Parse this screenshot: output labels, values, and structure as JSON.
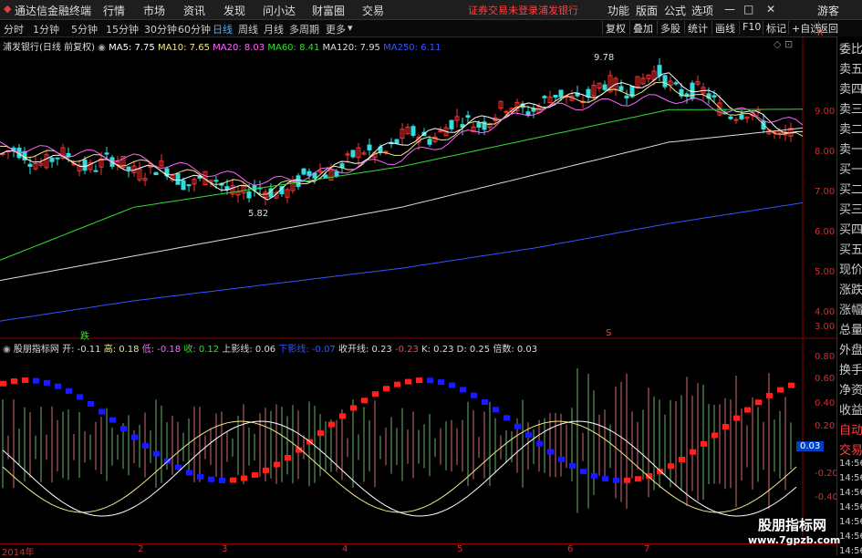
{
  "menu": {
    "app_title": "通达信金融终端",
    "items": [
      "行情",
      "市场",
      "资讯",
      "发现",
      "问小达",
      "财富圈",
      "交易"
    ],
    "notice": "证券交易未登录",
    "stock": "浦发银行",
    "right": [
      "功能",
      "版面",
      "公式",
      "选项"
    ],
    "guest": "游客",
    "win_buttons": [
      "—",
      "□",
      "✕"
    ]
  },
  "toolbar": {
    "periods": [
      "分时",
      "1分钟",
      "5分钟",
      "15分钟",
      "30分钟",
      "60分钟",
      "日线",
      "周线",
      "月线",
      "多周期",
      "更多"
    ],
    "active_period": "日线",
    "right_buttons": [
      "复权",
      "叠加",
      "多股",
      "统计",
      "画线",
      "F10",
      "标记",
      "+自选",
      "返回"
    ]
  },
  "main_legend": {
    "title": "浦发银行(日线 前复权)",
    "items": [
      {
        "label": "MA5: 7.75",
        "color": "#ffffff"
      },
      {
        "label": "MA10: 7.65",
        "color": "#f0e68c"
      },
      {
        "label": "MA20: 8.03",
        "color": "#ff66ff"
      },
      {
        "label": "MA60: 8.41",
        "color": "#33dd33"
      },
      {
        "label": "MA120: 7.95",
        "color": "#dddddd"
      },
      {
        "label": "MA250: 6.11",
        "color": "#3355ff"
      }
    ]
  },
  "price_axis": [
    "9.00",
    "8.00",
    "7.00",
    "6.00",
    "5.00",
    "4.00",
    "3.00"
  ],
  "price_annotations": {
    "high": "9.78",
    "low": "5.82"
  },
  "main_markers": {
    "fall": "跌",
    "s": "S"
  },
  "indicator_legend": {
    "title": "股朋指标网",
    "items": [
      {
        "label": "开: -0.11",
        "color": "#dddddd"
      },
      {
        "label": "高: 0.18",
        "color": "#f0e68c"
      },
      {
        "label": "低: -0.18",
        "color": "#ff66ff"
      },
      {
        "label": "收: 0.12",
        "color": "#33dd33"
      },
      {
        "label": "上影线: 0.06",
        "color": "#dddddd"
      },
      {
        "label": "下影线: -0.07",
        "color": "#3355ff"
      },
      {
        "label": "收开线: 0.23",
        "color": "#dddddd"
      },
      {
        "label": "-0.23",
        "color": "#ff4444"
      },
      {
        "label": "K: 0.23",
        "color": "#dddddd"
      },
      {
        "label": "D: 0.25",
        "color": "#dddddd"
      },
      {
        "label": "倍数: 0.03",
        "color": "#dddddd"
      }
    ]
  },
  "indicator_axis": [
    "0.80",
    "0.60",
    "0.40",
    "0.20",
    "0.03",
    "-0.20",
    "-0.40"
  ],
  "indicator_current": "0.03",
  "date_axis": [
    "2014年",
    "2",
    "3",
    "4",
    "5",
    "6",
    "7"
  ],
  "side_panel": [
    "委比",
    "卖五",
    "卖四",
    "卖三",
    "卖二",
    "卖一",
    "买一",
    "买二",
    "买三",
    "买四",
    "买五",
    "现价",
    "涨跌",
    "涨幅",
    "总量",
    "外盘",
    "换手",
    "净资",
    "收益",
    "自动",
    "交易",
    "14:56",
    "14:56",
    "14:56",
    "14:56",
    "14:56",
    "14:56",
    "14:56",
    "14:56",
    "14:56"
  ],
  "watermark": {
    "line1": "股朋指标网",
    "line2": "www.7gpzb.com"
  },
  "chart_data": {
    "type": "line",
    "title": "浦发银行(日线 前复权)",
    "x": [
      "2014-01",
      "2014-02",
      "2014-03",
      "2014-04",
      "2014-05",
      "2014-06",
      "2014-07"
    ],
    "series": [
      {
        "name": "MA5",
        "values": [
          7.3,
          7.0,
          6.3,
          7.6,
          8.5,
          9.2,
          7.75
        ]
      },
      {
        "name": "MA10",
        "values": [
          7.4,
          7.1,
          6.4,
          7.4,
          8.5,
          9.0,
          7.65
        ]
      },
      {
        "name": "MA20",
        "values": [
          7.5,
          7.2,
          6.6,
          7.2,
          8.4,
          8.7,
          8.03
        ]
      },
      {
        "name": "MA60",
        "values": [
          4.7,
          6.0,
          6.5,
          7.0,
          7.7,
          8.4,
          8.41
        ]
      },
      {
        "name": "MA120",
        "values": [
          4.2,
          4.8,
          5.4,
          6.0,
          6.8,
          7.6,
          7.95
        ]
      },
      {
        "name": "MA250",
        "values": [
          3.2,
          3.7,
          4.1,
          4.5,
          5.0,
          5.6,
          6.11
        ]
      }
    ],
    "ylim": [
      2.8,
      10.2
    ],
    "annotations": [
      {
        "label": "9.78",
        "x": "2014-06"
      },
      {
        "label": "5.82",
        "x": "2014-03"
      }
    ]
  }
}
